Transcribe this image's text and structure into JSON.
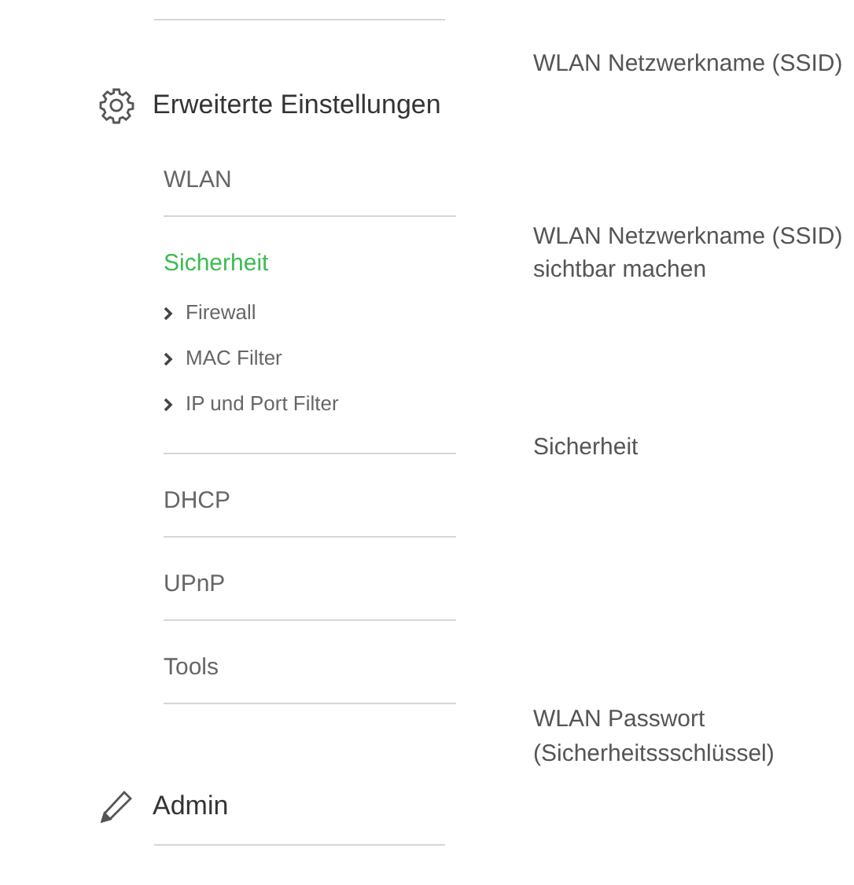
{
  "sidebar": {
    "sections": [
      {
        "kind": "settings",
        "title": "Erweiterte Einstellungen",
        "items": [
          {
            "label": "WLAN",
            "selected": false
          },
          {
            "label": "Sicherheit",
            "selected": true,
            "expanded": true,
            "children": [
              "Firewall",
              "MAC Filter",
              "IP und Port Filter"
            ]
          },
          {
            "label": "DHCP",
            "selected": false
          },
          {
            "label": "UPnP",
            "selected": false
          },
          {
            "label": "Tools",
            "selected": false
          }
        ]
      },
      {
        "kind": "admin",
        "title": "Admin"
      }
    ]
  },
  "form": {
    "labels": [
      "WLAN Netzwerkname (SSID)",
      "WLAN Netzwerkname (SSID) sichtbar machen",
      "Sicherheit",
      "WLAN Passwort (Sicherheitssschlüssel)"
    ]
  }
}
